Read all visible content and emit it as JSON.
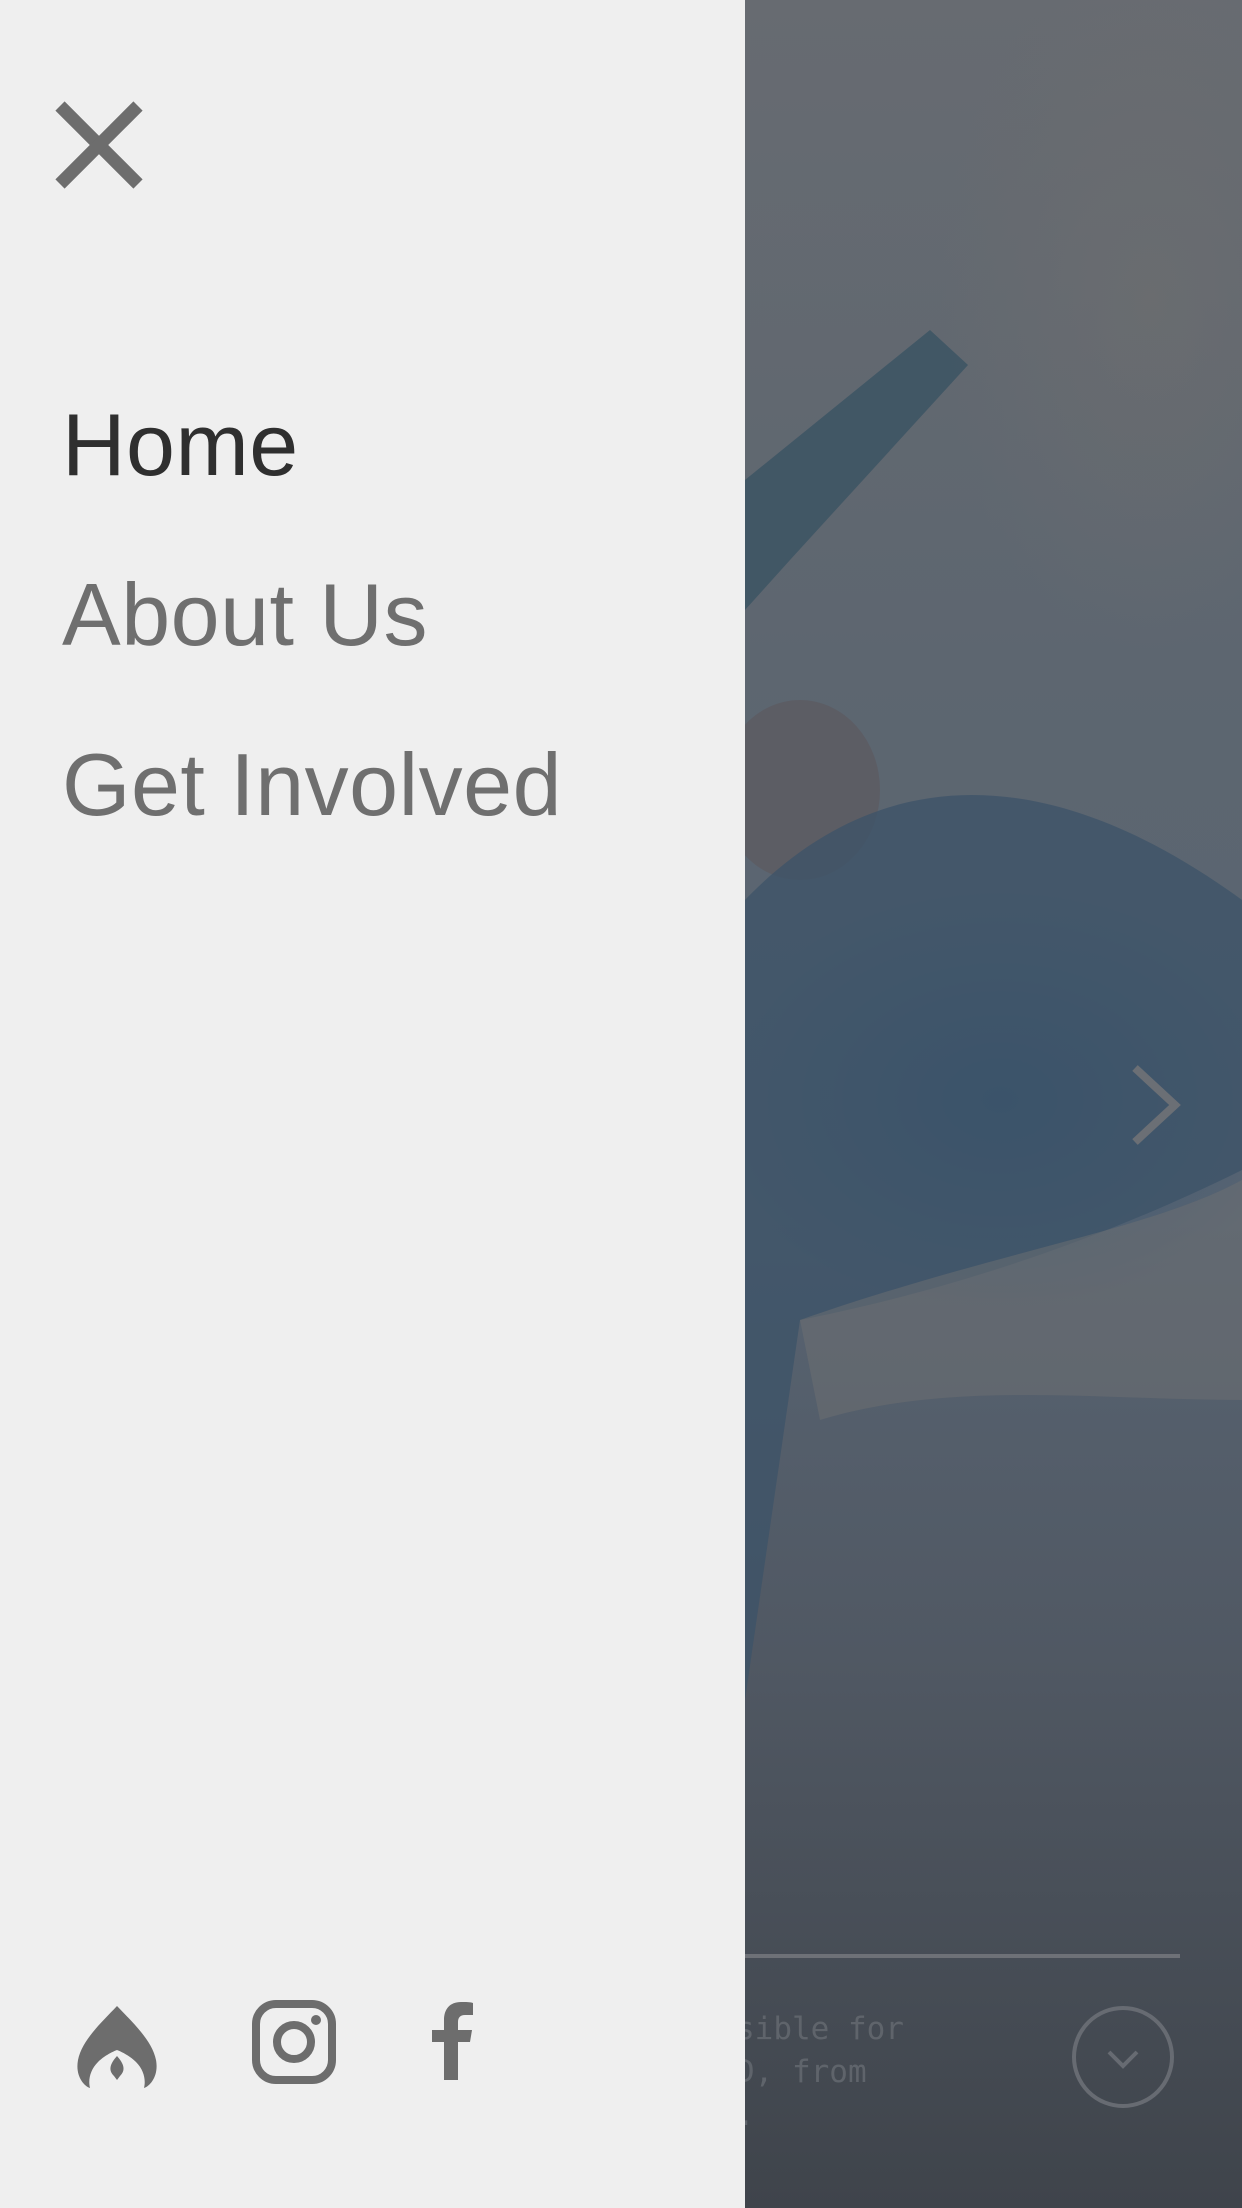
{
  "drawer": {
    "nav": [
      {
        "label": "Home",
        "active": true
      },
      {
        "label": "About Us",
        "active": false
      },
      {
        "label": "Get Involved",
        "active": false
      }
    ],
    "social": [
      "brand-flame-icon",
      "instagram-icon",
      "facebook-icon"
    ]
  },
  "hero": {
    "caption": "ponsible for\nUCSD, from\nval.",
    "icons": [
      "chevron-right-icon",
      "chevron-down-icon"
    ]
  },
  "colors": {
    "drawer_bg": "#efefef",
    "nav_active": "#2f2f2f",
    "nav_inactive": "#6f6f6f",
    "icon": "#6d6d6d"
  }
}
